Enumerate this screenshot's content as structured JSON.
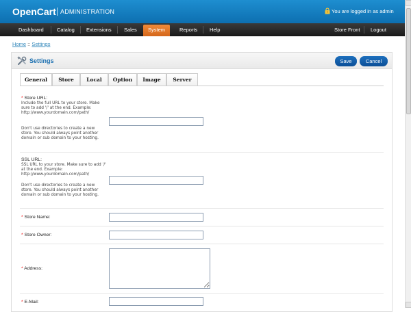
{
  "header": {
    "logo": "OpenCart",
    "subtitle": "ADMINISTRATION",
    "logged_in": "You are logged in as admin"
  },
  "nav": {
    "items": [
      "Dashboard",
      "Catalog",
      "Extensions",
      "Sales",
      "System",
      "Reports",
      "Help"
    ],
    "active": "System",
    "right": [
      "Store Front",
      "Logout"
    ]
  },
  "breadcrumb": {
    "home": "Home",
    "separator": " :: ",
    "current": "Settings"
  },
  "panel": {
    "title": "Settings",
    "save": "Save",
    "cancel": "Cancel"
  },
  "tabs": [
    "General",
    "Store",
    "Local",
    "Option",
    "Image",
    "Server"
  ],
  "active_tab": "General",
  "form": {
    "required_mark": "*",
    "store_url": {
      "label": "Store URL:",
      "help1": "Include the full URL to your store. Make sure to add '/' at the end. Example: http://www.yourdomain.com/path/",
      "help2": "Don't use directories to create a new store. You should always point another domain or sub domain to your hosting.",
      "value": ""
    },
    "ssl_url": {
      "label": "SSL URL:",
      "help1": "SSL URL to your store. Make sure to add '/' at the end. Example: http://www.yourdomain.com/path/",
      "help2": "Don't use directories to create a new store. You should always point another domain or sub domain to your hosting.",
      "value": ""
    },
    "store_name": {
      "label": "Store Name:",
      "value": ""
    },
    "store_owner": {
      "label": "Store Owner:",
      "value": ""
    },
    "address": {
      "label": "Address:",
      "value": ""
    },
    "email": {
      "label": "E-Mail:",
      "value": ""
    }
  },
  "colors": {
    "header": "#1e8ed0",
    "nav": "#2a2a2a",
    "nav_active": "#e3772a",
    "button": "#1560ac",
    "title": "#1a6fb0",
    "required": "#e00000"
  }
}
